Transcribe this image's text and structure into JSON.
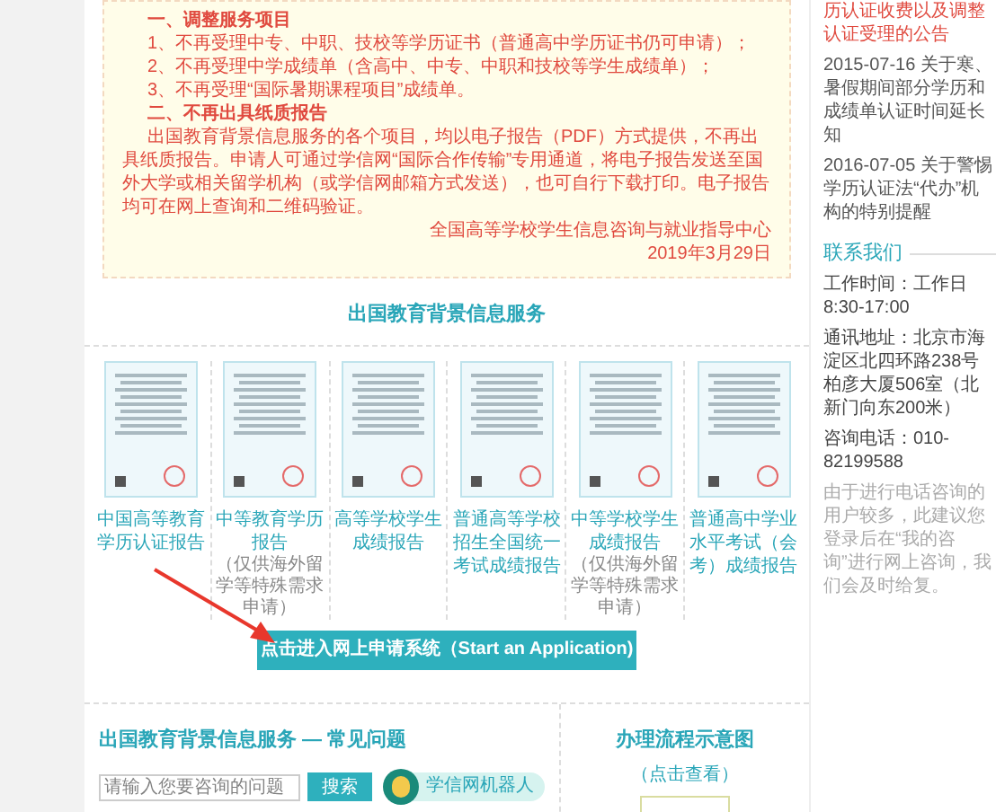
{
  "notice": {
    "lines": [
      {
        "kind": "heading",
        "text": "一、调整服务项目"
      },
      {
        "kind": "item",
        "text": "1、不再受理中专、中职、技校等学历证书（普通高中学历证书仍可申请）；"
      },
      {
        "kind": "item",
        "text": "2、不再受理中学成绩单（含高中、中专、中职和技校等学生成绩单）；"
      },
      {
        "kind": "item",
        "text": "3、不再受理“国际暑期课程项目”成绩单。"
      },
      {
        "kind": "heading",
        "text": "二、不再出具纸质报告"
      },
      {
        "kind": "paragraph",
        "text": "出国教育背景信息服务的各个项目，均以电子报告（PDF）方式提供，不再出具纸质报告。申请人可通过学信网“国际合作传输”专用通道，将电子报告发送至国外大学或相关留学机构（或学信网邮箱方式发送），也可自行下载打印。电子报告均可在网上查询和二维码验证。"
      },
      {
        "kind": "signature",
        "text": "全国高等学校学生信息咨询与就业指导中心"
      },
      {
        "kind": "signature",
        "text": "2019年3月29日"
      }
    ]
  },
  "services": {
    "title": "出国教育背景信息服务",
    "items": [
      {
        "label": "中国高等教育学历认证报告"
      },
      {
        "label": "中等教育学历报告",
        "note": "（仅供海外留学等特殊需求申请）"
      },
      {
        "label": "高等学校学生成绩报告"
      },
      {
        "label": "普通高等学校招生全国统一考试成绩报告"
      },
      {
        "label": "中等学校学生成绩报告",
        "note": "（仅供海外留学等特殊需求申请）"
      },
      {
        "label": "普通高中学业水平考试（会考）成绩报告"
      }
    ],
    "apply_button": "点击进入网上申请系统（Start an Application)"
  },
  "faq": {
    "title": "出国教育背景信息服务 — 常见问题",
    "search": {
      "placeholder": "请输入您要咨询的问题"
    },
    "search_button": "搜索",
    "robot": "学信网机器人"
  },
  "process": {
    "title": "办理流程示意图",
    "link": "（点击查看）"
  },
  "sidebar": {
    "news": [
      {
        "text": "历认证收费以及调整认证受理的公告",
        "highlight": true
      },
      {
        "text": "2015-07-16 关于寒、暑假期间部分学历和成绩单认证时间延长知",
        "highlight": false
      },
      {
        "text": "2016-07-05 关于警惕学历认证法“代办”机构的特别提醒",
        "highlight": false
      }
    ],
    "contact": {
      "title": "联系我们",
      "lines": [
        {
          "kind": "info",
          "text": "工作时间：工作日8:30-17:00"
        },
        {
          "kind": "info",
          "text": "通讯地址：北京市海淀区北四环路238号柏彦大厦506室（北新门向东200米）"
        },
        {
          "kind": "info",
          "text": "咨询电话：010-82199588"
        },
        {
          "kind": "hint",
          "text": "由于进行电话咨询的用户较多，此建议您登录后在“我的咨询”进行网上咨询，我们会及时给复。"
        }
      ]
    }
  }
}
